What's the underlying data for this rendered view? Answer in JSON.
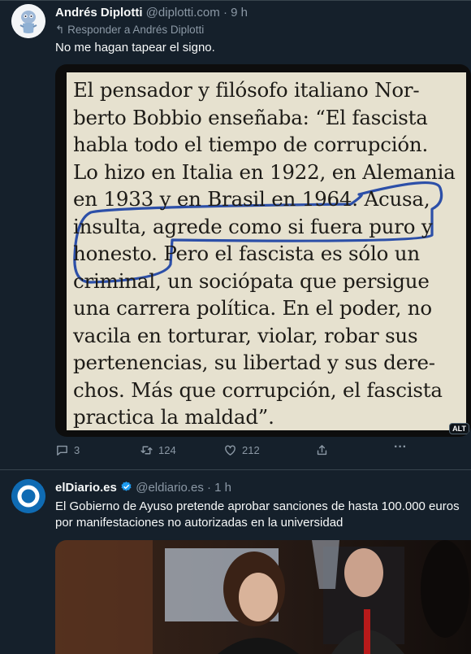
{
  "tweet1": {
    "author_name": "Andrés Diplotti",
    "handle": "@diplotti.com",
    "separator": "·",
    "time": "9 h",
    "reply_prefix": "Responder a",
    "reply_to": "Andrés Diplotti",
    "text": "No me hagan tapear el signo.",
    "image_text_lines": [
      "El pensador y filósofo italiano Nor-",
      "berto Bobbio enseñaba: “El fascista",
      "habla todo el tiempo de corrupción.",
      "Lo hizo en Italia en 1922, en Alemania",
      "en 1933 y en Brasil en 1964. Acusa,",
      "insulta, agrede como si fuera puro y",
      "honesto. Pero el fascista es sólo un",
      "criminal, un sociópata que persigue",
      "una carrera política. En el poder, no",
      "vacila en torturar, violar, robar sus",
      "pertenencias, su libertad y sus dere-",
      "chos. Más que corrupción, el fascista",
      "practica la maldad”."
    ],
    "alt_badge": "ALT",
    "replies": "3",
    "reposts": "124",
    "likes": "212"
  },
  "tweet2": {
    "author_name": "elDiario.es",
    "handle": "@eldiario.es",
    "separator": "·",
    "time": "1 h",
    "text": "El Gobierno de Ayuso pretende aprobar sanciones de hasta 100.000 euros por manifestaciones no autorizadas en la universidad"
  },
  "colors": {
    "background": "#15202b",
    "text": "#f7f9f9",
    "muted": "#8b98a5",
    "divider": "#38444d",
    "verified": "#1d9bf0",
    "annotation": "#2c4fa8"
  },
  "icons": {
    "reply_indicator": "reply-arrow-icon",
    "replies": "comment-icon",
    "reposts": "repost-icon",
    "likes": "heart-icon",
    "share": "share-icon",
    "more": "more-icon",
    "verified": "verified-badge-icon"
  }
}
